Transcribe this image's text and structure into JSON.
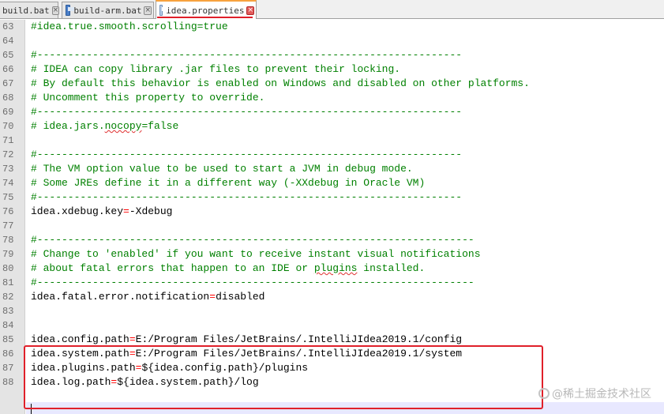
{
  "tabs": [
    {
      "label": "build.bat",
      "active": false
    },
    {
      "label": "build-arm.bat",
      "active": false
    },
    {
      "label": "idea.properties",
      "active": true
    }
  ],
  "lines": [
    {
      "num": "63",
      "segs": [
        {
          "t": "#idea.true.smooth.scrolling=true",
          "c": "cmt"
        }
      ]
    },
    {
      "num": "64",
      "segs": []
    },
    {
      "num": "65",
      "segs": [
        {
          "t": "#---------------------------------------------------------------------",
          "c": "cmt"
        }
      ]
    },
    {
      "num": "66",
      "segs": [
        {
          "t": "# IDEA can copy library .jar files to prevent their locking.",
          "c": "cmt"
        }
      ]
    },
    {
      "num": "67",
      "segs": [
        {
          "t": "# By default this behavior is enabled on Windows and disabled on other platforms.",
          "c": "cmt"
        }
      ]
    },
    {
      "num": "68",
      "segs": [
        {
          "t": "# Uncomment this property to override.",
          "c": "cmt"
        }
      ]
    },
    {
      "num": "69",
      "segs": [
        {
          "t": "#---------------------------------------------------------------------",
          "c": "cmt"
        }
      ]
    },
    {
      "num": "70",
      "segs": [
        {
          "t": "# idea.jars.",
          "c": "cmt"
        },
        {
          "t": "nocopy",
          "c": "cmt squiggle"
        },
        {
          "t": "=false",
          "c": "cmt"
        }
      ]
    },
    {
      "num": "71",
      "segs": []
    },
    {
      "num": "72",
      "segs": [
        {
          "t": "#---------------------------------------------------------------------",
          "c": "cmt"
        }
      ]
    },
    {
      "num": "73",
      "segs": [
        {
          "t": "# The VM option value to be used to start a JVM in debug mode.",
          "c": "cmt"
        }
      ]
    },
    {
      "num": "74",
      "segs": [
        {
          "t": "# Some JREs define it in a different way (-XXdebug in Oracle VM)",
          "c": "cmt"
        }
      ]
    },
    {
      "num": "75",
      "segs": [
        {
          "t": "#---------------------------------------------------------------------",
          "c": "cmt"
        }
      ]
    },
    {
      "num": "76",
      "segs": [
        {
          "t": "idea.xdebug.key",
          "c": "key"
        },
        {
          "t": "=",
          "c": "eq"
        },
        {
          "t": "-Xdebug",
          "c": "val"
        }
      ]
    },
    {
      "num": "77",
      "segs": []
    },
    {
      "num": "78",
      "segs": [
        {
          "t": "#-----------------------------------------------------------------------",
          "c": "cmt"
        }
      ]
    },
    {
      "num": "79",
      "segs": [
        {
          "t": "# Change to 'enabled' if you want to receive instant visual notifications",
          "c": "cmt"
        }
      ]
    },
    {
      "num": "80",
      "segs": [
        {
          "t": "# about fatal errors that happen to an IDE or ",
          "c": "cmt"
        },
        {
          "t": "plugins",
          "c": "cmt squiggle"
        },
        {
          "t": " installed.",
          "c": "cmt"
        }
      ]
    },
    {
      "num": "81",
      "segs": [
        {
          "t": "#-----------------------------------------------------------------------",
          "c": "cmt"
        }
      ]
    },
    {
      "num": "82",
      "segs": [
        {
          "t": "idea.fatal.error.notification",
          "c": "key"
        },
        {
          "t": "=",
          "c": "eq"
        },
        {
          "t": "disabled",
          "c": "val"
        }
      ]
    },
    {
      "num": "83",
      "segs": []
    },
    {
      "num": "84",
      "segs": []
    },
    {
      "num": "85",
      "segs": [
        {
          "t": "idea.config.path",
          "c": "key"
        },
        {
          "t": "=",
          "c": "eq"
        },
        {
          "t": "E:/Program Files/JetBrains/.IntelliJIdea2019.1/config",
          "c": "val"
        }
      ]
    },
    {
      "num": "86",
      "segs": [
        {
          "t": "idea.system.path",
          "c": "key"
        },
        {
          "t": "=",
          "c": "eq"
        },
        {
          "t": "E:/Program Files/JetBrains/.IntelliJIdea2019.1/system",
          "c": "val"
        }
      ]
    },
    {
      "num": "87",
      "segs": [
        {
          "t": "idea.plugins.path",
          "c": "key"
        },
        {
          "t": "=",
          "c": "eq"
        },
        {
          "t": "${idea.config.path}/plugins",
          "c": "val"
        }
      ]
    },
    {
      "num": "88",
      "segs": [
        {
          "t": "idea.log.path",
          "c": "key"
        },
        {
          "t": "=",
          "c": "eq"
        },
        {
          "t": "${idea.system.path}/log",
          "c": "val"
        }
      ]
    }
  ],
  "watermark": "@稀土掘金技术社区",
  "colors": {
    "comment": "#008000",
    "operator": "#ff0000",
    "highlight_box": "#e0202a",
    "gutter": "#e4e4e4"
  }
}
